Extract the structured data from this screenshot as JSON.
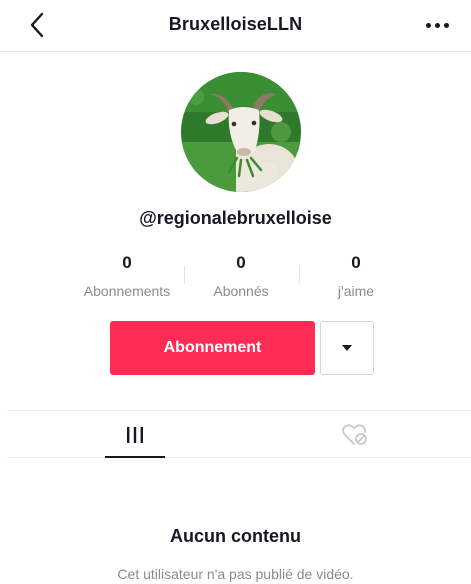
{
  "header": {
    "title": "BruxelloiseLLN",
    "back_icon": "chevron-left-icon",
    "more_icon": "more-horizontal-icon"
  },
  "profile": {
    "avatar_icon": "goat-avatar-image",
    "handle": "@regionalebruxelloise"
  },
  "stats": [
    {
      "value": "0",
      "label": "Abonnements"
    },
    {
      "value": "0",
      "label": "Abonnés"
    },
    {
      "value": "0",
      "label": "j'aime"
    }
  ],
  "actions": {
    "follow_label": "Abonnement",
    "dropdown_icon": "caret-down-icon"
  },
  "tabs": [
    {
      "icon": "videos-grid-icon",
      "active": true
    },
    {
      "icon": "liked-hidden-icon",
      "active": false
    }
  ],
  "empty_state": {
    "title": "Aucun contenu",
    "description": "Cet utilisateur n'a pas publié de vidéo."
  },
  "colors": {
    "accent": "#fe2c55",
    "text": "#161823",
    "muted": "#8a8b91",
    "divider": "#e3e3e4"
  }
}
